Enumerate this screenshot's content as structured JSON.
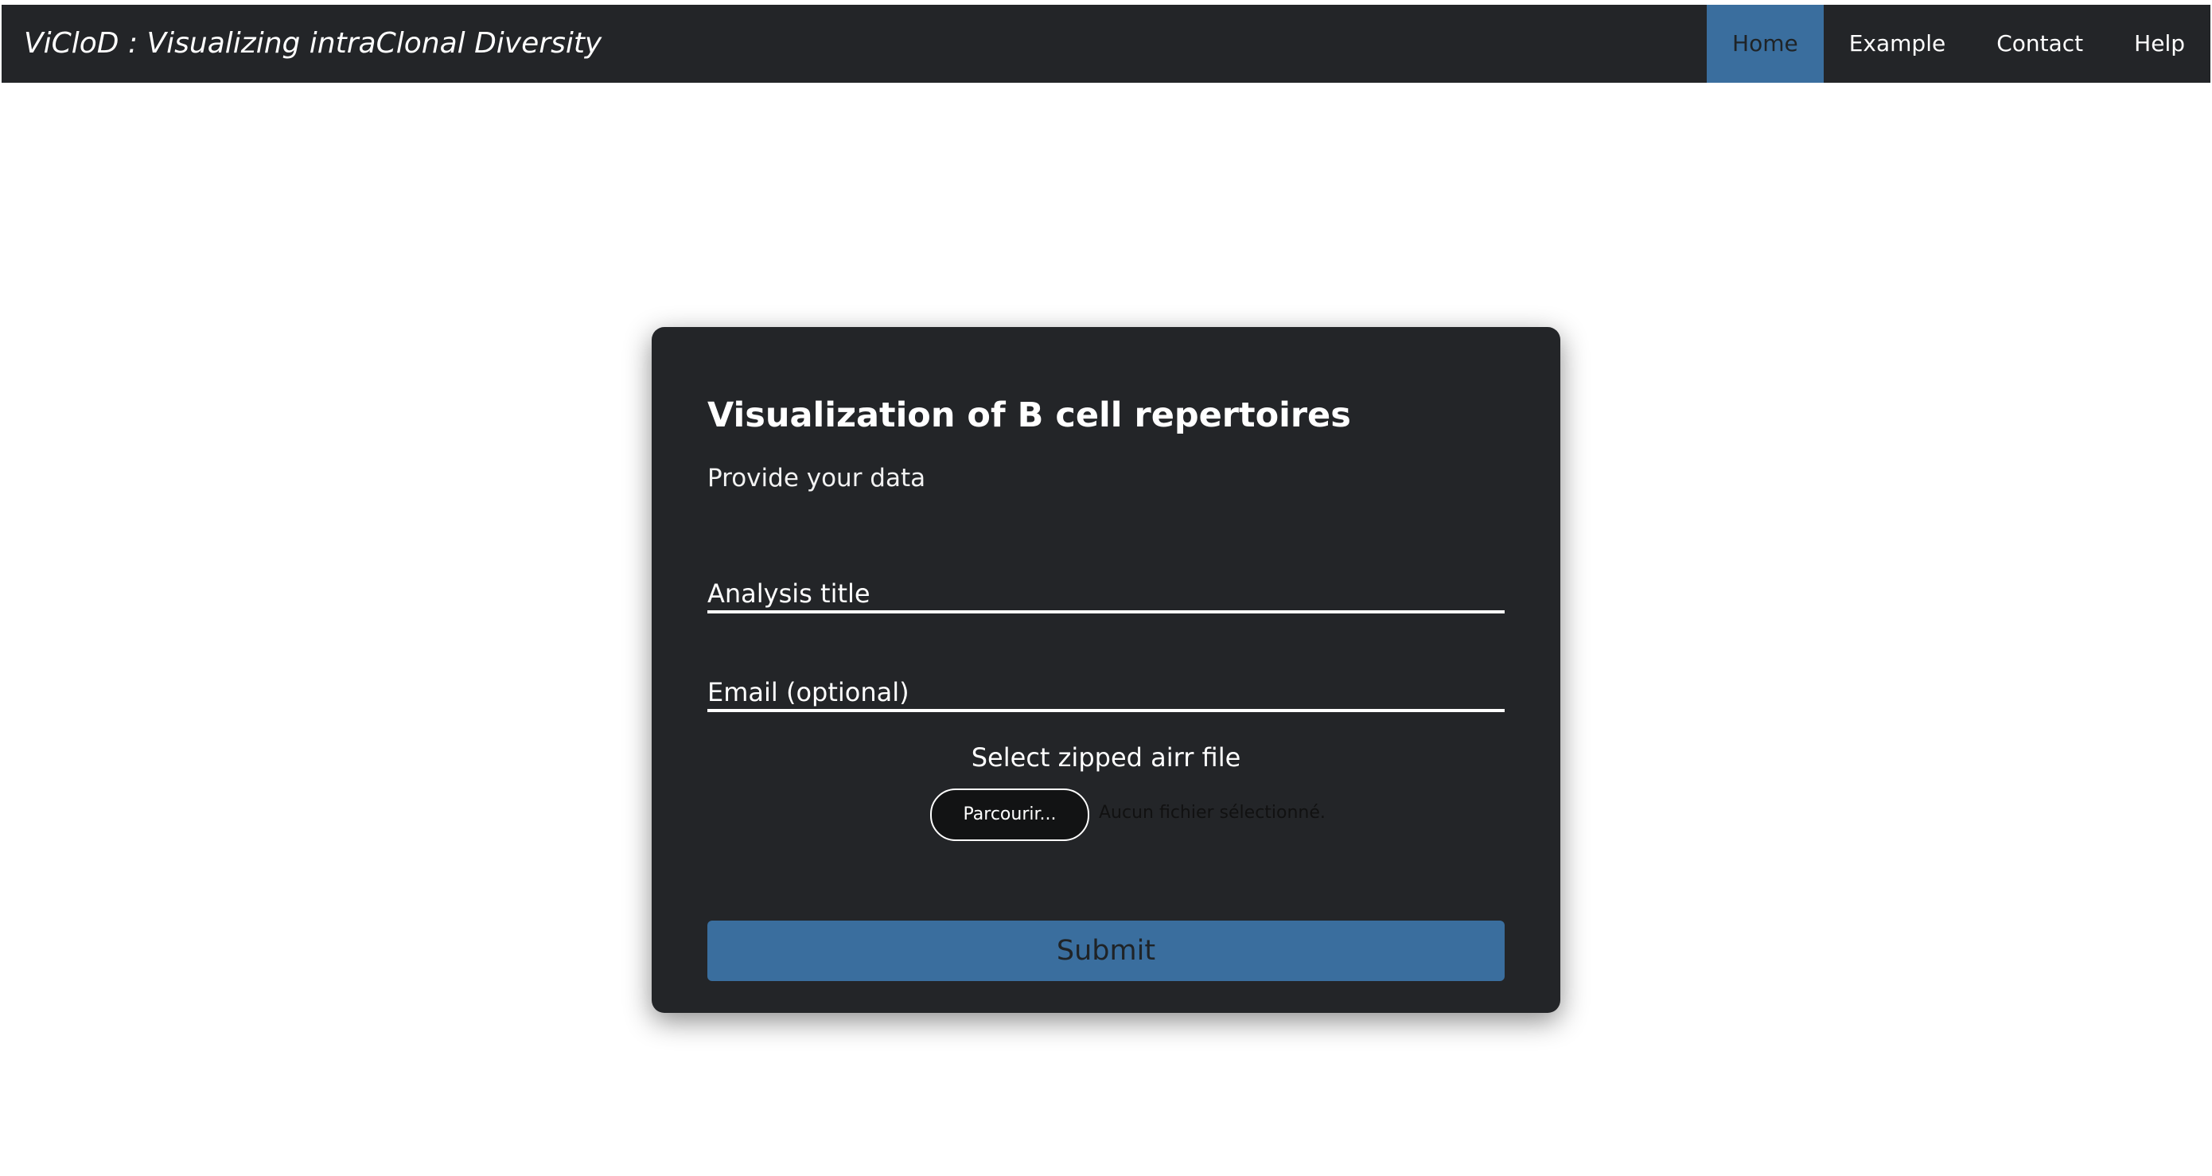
{
  "navbar": {
    "brand": "ViCloD : Visualizing intraClonal Diversity",
    "items": [
      {
        "label": "Home",
        "active": true
      },
      {
        "label": "Example",
        "active": false
      },
      {
        "label": "Contact",
        "active": false
      },
      {
        "label": "Help",
        "active": false
      }
    ]
  },
  "form": {
    "title": "Visualization of B cell repertoires",
    "subtitle": "Provide your data",
    "analysis_title_placeholder": "Analysis title",
    "email_placeholder": "Email (optional)",
    "file_label": "Select zipped airr file",
    "file_button": "Parcourir...",
    "file_status": "Aucun fichier sélectionné.",
    "submit_label": "Submit"
  },
  "colors": {
    "navbar_bg": "#232528",
    "accent": "#3a6e9e",
    "card_bg": "#232528"
  }
}
